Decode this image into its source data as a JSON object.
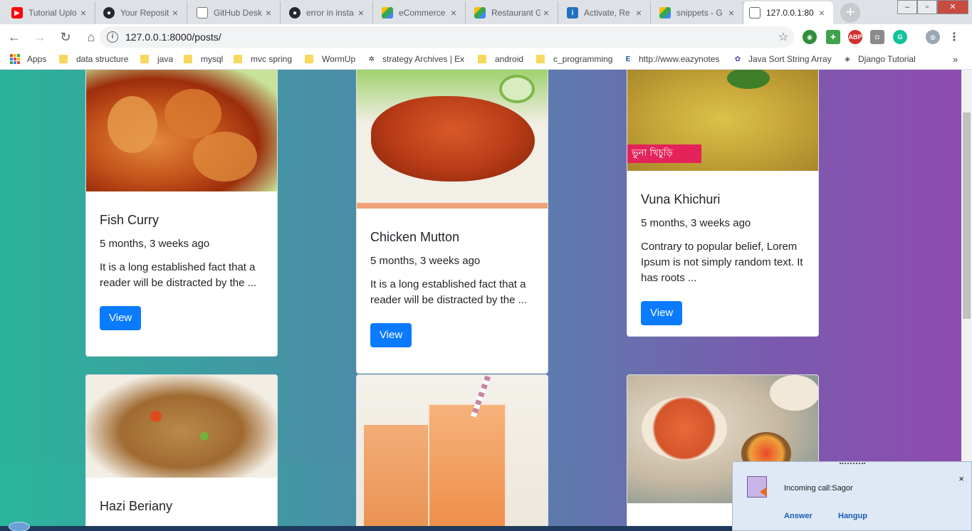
{
  "tabs": [
    {
      "title": "Tutorial Uplo",
      "icon": "youtube-icon",
      "color": "#ff0000"
    },
    {
      "title": "Your Reposit",
      "icon": "github-icon",
      "color": "#24292e"
    },
    {
      "title": "GitHub Desk",
      "icon": "document-icon",
      "color": "#777777"
    },
    {
      "title": "error in insta",
      "icon": "github-icon",
      "color": "#24292e"
    },
    {
      "title": "eCommerce",
      "icon": "drive-icon",
      "color": "#34a853"
    },
    {
      "title": "Restaurant G",
      "icon": "drive-icon",
      "color": "#fbbc04"
    },
    {
      "title": "Activate, Re",
      "icon": "activate-icon",
      "color": "#1e73be"
    },
    {
      "title": "snippets - G",
      "icon": "drive-icon",
      "color": "#34a853"
    },
    {
      "title": "127.0.0.1:80",
      "icon": "page-icon",
      "color": "#5f6368",
      "active": true
    }
  ],
  "address": {
    "url": "127.0.0.1:8000/posts/"
  },
  "bookmarks": [
    {
      "label": "Apps",
      "type": "apps"
    },
    {
      "label": "data structure",
      "type": "folder"
    },
    {
      "label": "java",
      "type": "folder"
    },
    {
      "label": "mysql",
      "type": "folder"
    },
    {
      "label": "mvc spring",
      "type": "folder"
    },
    {
      "label": "WormUp",
      "type": "folder"
    },
    {
      "label": "strategy Archives | Ex",
      "type": "site"
    },
    {
      "label": "android",
      "type": "folder"
    },
    {
      "label": "c_programming",
      "type": "folder"
    },
    {
      "label": "http://www.eazynotes",
      "type": "site"
    },
    {
      "label": "Java Sort String Array",
      "type": "site"
    },
    {
      "label": "Django Tutorial",
      "type": "site"
    }
  ],
  "posts": [
    {
      "title": "Fish Curry",
      "date": "5 months, 3 weeks ago",
      "excerpt": "It is a long established fact that a reader will be distracted by the ...",
      "button": "View"
    },
    {
      "title": "Chicken Mutton",
      "date": "5 months, 3 weeks ago",
      "excerpt": "It is a long established fact that a reader will be distracted by the ...",
      "button": "View"
    },
    {
      "title": "Vuna Khichuri",
      "date": "5 months, 3 weeks ago",
      "excerpt": "Contrary to popular belief, Lorem Ipsum is not simply random text. It has roots ...",
      "button": "View",
      "image_caption": "ভুনা খিচুড়ি"
    },
    {
      "title": "Hazi Beriany",
      "date": "",
      "excerpt": "",
      "button": ""
    }
  ],
  "call": {
    "message": "Incoming call:Sagor",
    "answer": "Answer",
    "hangup": "Hangup",
    "close": "×"
  },
  "colors": {
    "button": "#0a7bff",
    "gradient_start": "#2bb39a",
    "gradient_end": "#8e4cb1"
  }
}
